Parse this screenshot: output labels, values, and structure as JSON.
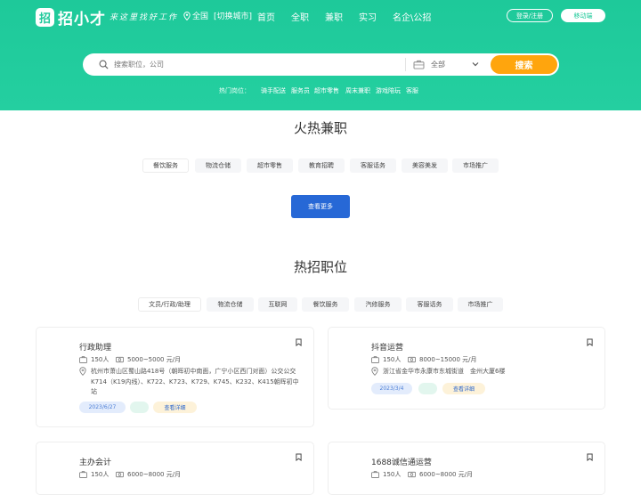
{
  "header": {
    "logo_glyph": "招",
    "logo_text": "招小才",
    "slogan": "来这里找好工作",
    "city": "全国",
    "city_switch": "[切换城市]",
    "nav": [
      "首页",
      "全职",
      "兼职",
      "实习",
      "名企\\公招"
    ],
    "login_label": "登录/注册",
    "mobile_label": "移动端",
    "brand_color": "#1ec99a"
  },
  "search": {
    "placeholder": "搜索职位，公司",
    "category": "全部",
    "button_label": "搜索",
    "hot_label": "热门岗位：",
    "hot_links": [
      "骑手配送",
      "服务员",
      "超市零售",
      "周末兼职",
      "游戏陪玩",
      "客服"
    ]
  },
  "parttime": {
    "title": "火热兼职",
    "tags": [
      "餐饮服务",
      "物流仓储",
      "超市零售",
      "教育招聘",
      "客服话务",
      "美容美发",
      "市场推广"
    ],
    "more_label": "查看更多"
  },
  "hotjobs": {
    "title": "热招职位",
    "tags": [
      "文员/行政/助理",
      "物流仓储",
      "互联网",
      "餐饮服务",
      "汽修服务",
      "客服话务",
      "市场推广"
    ],
    "cards": [
      {
        "title": "行政助理",
        "headcount": "150人",
        "salary": "5000~5000 元/月",
        "address": "杭州市萧山区蜀山路418号（朝晖初中南面，广宁小区西门对面）公交公交K714（K19内线）、K722、K723、K729、K745、K232、K415朝晖初中站",
        "date": "2023/6/27",
        "detail_label": "查看详细"
      },
      {
        "title": "抖音运营",
        "headcount": "150人",
        "salary": "8000~15000 元/月",
        "address": "浙江省金华市永康市东城街道　金州大厦6楼",
        "date": "2023/3/4",
        "detail_label": "查看详细"
      },
      {
        "title": "主办会计",
        "headcount": "150人",
        "salary": "6000~8000 元/月"
      },
      {
        "title": "1688诚信通运营",
        "headcount": "150人",
        "salary": "6000~8000 元/月"
      }
    ]
  }
}
